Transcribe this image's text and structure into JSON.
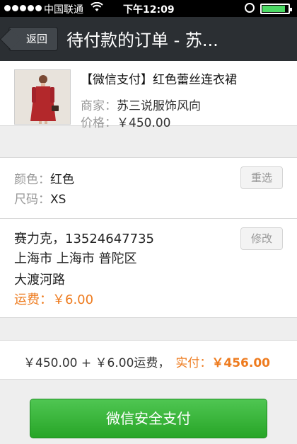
{
  "status_bar": {
    "carrier": "中国联通",
    "time": "下午12:09",
    "battery_level": 0.9
  },
  "nav": {
    "back_label": "返回",
    "title": "待付款的订单 - 苏..."
  },
  "product": {
    "name": "【微信支付】红色蕾丝连衣裙",
    "merchant_label": "商家：",
    "merchant": "苏三说服饰风向",
    "price_label": "价格：",
    "price": "￥450.00"
  },
  "spec": {
    "color_label": "颜色：",
    "color": "红色",
    "size_label": "尺码：",
    "size": "XS",
    "reselect_label": "重选"
  },
  "address": {
    "recipient": "赛力克，13524647735",
    "region": "上海市 上海市 普陀区",
    "street": "大渡河路",
    "shipping_label": "运费：",
    "shipping_fee": "￥6.00",
    "edit_label": "修改"
  },
  "total": {
    "breakdown": "￥450.00 + ￥6.00运费，",
    "paid_label": "实付：",
    "paid_amount": "￥456.00"
  },
  "pay_button": {
    "label": "微信安全支付"
  },
  "colors": {
    "accent_orange": "#ee7b1e",
    "pay_green": "#3cb83c",
    "nav_bg": "#2b2f33"
  }
}
